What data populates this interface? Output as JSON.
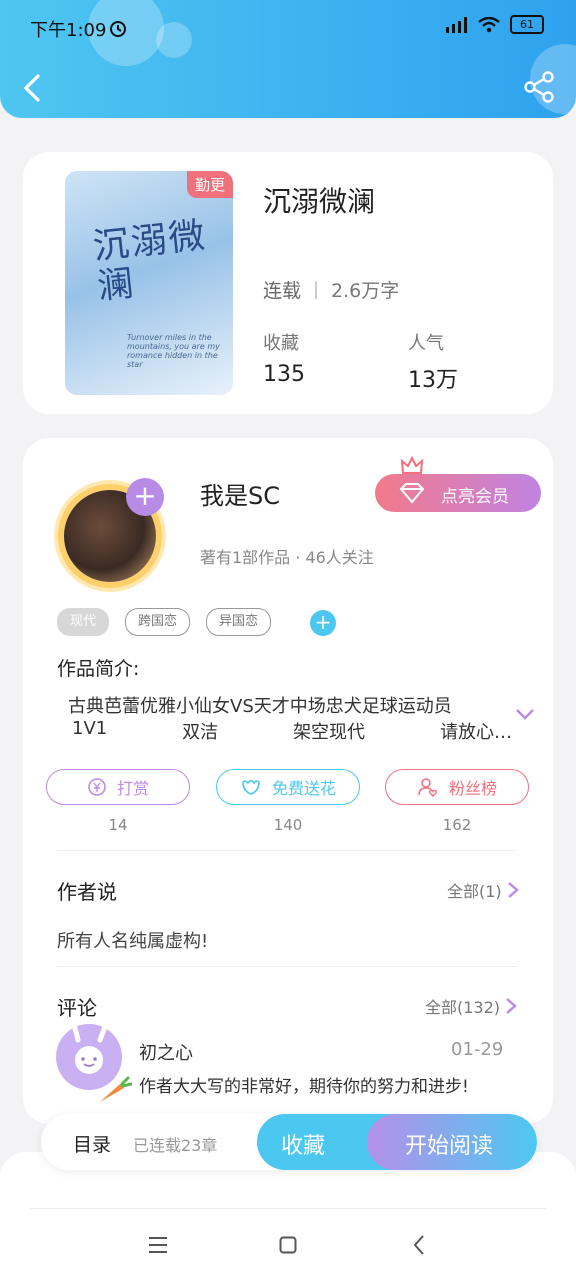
{
  "status_bar": {
    "time": "下午1:09",
    "battery": "61"
  },
  "book": {
    "badge": "勤更",
    "cover_title": "沉溺微澜",
    "cover_subtitle": "Turnover miles in the mountains, you are my romance hidden in the star",
    "title": "沉溺微澜",
    "status": "连载",
    "word_count": "2.6万字",
    "favorites_label": "收藏",
    "favorites_value": "135",
    "popularity_label": "人气",
    "popularity_value": "13万"
  },
  "author": {
    "name": "我是SC",
    "subtitle": "著有1部作品 · 46人关注",
    "vip_label": "点亮会员"
  },
  "tags": [
    "现代",
    "跨国恋",
    "异国恋"
  ],
  "intro": {
    "heading": "作品简介:",
    "line1": "古典芭蕾优雅小仙女VS天才中场忠犬足球运动员",
    "line2_parts": [
      "1V1",
      "双洁",
      "架空现代",
      "请放心…"
    ]
  },
  "actions": [
    {
      "label": "打赏",
      "count": "14",
      "color": "#c08ae3",
      "icon": "coin-icon"
    },
    {
      "label": "免费送花",
      "count": "140",
      "color": "#4cc8f0",
      "icon": "flower-icon"
    },
    {
      "label": "粉丝榜",
      "count": "162",
      "color": "#f0707c",
      "icon": "fans-icon"
    }
  ],
  "author_says": {
    "title": "作者说",
    "link": "全部(1)",
    "text": "所有人名纯属虚构!"
  },
  "comments": {
    "title": "评论",
    "link": "全部(132)",
    "items": [
      {
        "user": "初之心",
        "date": "01-29",
        "text": "作者大大写的非常好，期待你的努力和进步!"
      }
    ]
  },
  "bottom_bar": {
    "toc": "目录",
    "serialized": "已连载23章",
    "favorite": "收藏",
    "read": "开始阅读"
  }
}
